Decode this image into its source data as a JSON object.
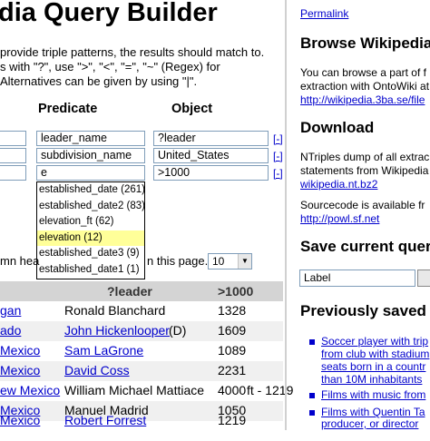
{
  "title": "dia Query Builder",
  "intro": [
    "provide triple patterns, the results should match to.",
    "s with \"?\", use \">\", \"<\", \"=\", \"~\" (Regex) for",
    "Alternatives can be given by using \"|\"."
  ],
  "columns": {
    "predicate": "Predicate",
    "object": "Object"
  },
  "patterns": [
    {
      "subject": "",
      "predicate": "leader_name",
      "object": "?leader",
      "remove": "[-]"
    },
    {
      "subject": "",
      "predicate": "subdivision_name",
      "object": "United_States",
      "remove": "[-]"
    },
    {
      "subject": "",
      "predicate": "e",
      "object": ">1000",
      "remove": "[-]"
    }
  ],
  "autocomplete": [
    "established_date (261)",
    "established_date2 (83)",
    "elevation_ft (62)",
    "elevation (12)",
    "established_date3 (9)",
    "established_date1 (1)"
  ],
  "autocomplete_selected_index": 3,
  "limit": {
    "prefix": "mn hea",
    "suffix": "n this page.",
    "value": "10"
  },
  "results": {
    "headers": [
      "",
      "?leader",
      ">1000"
    ],
    "rows": [
      [
        "gan",
        "Ronald Blanchard",
        "1328"
      ],
      [
        "ado",
        "John Hickenlooper",
        "1609"
      ],
      [
        "Mexico",
        "Sam LaGrone",
        "1089"
      ],
      [
        "Mexico",
        "David Coss",
        "2231"
      ],
      [
        "ew Mexico",
        "William Michael Mattiace",
        "4000"
      ],
      [
        "Mexico",
        "Manuel Madrid",
        "1050"
      ],
      [
        "Mexico",
        "Robert Forrest",
        "1219"
      ]
    ],
    "row2_extra": "(D)",
    "row5_extra": "ft - 1219"
  },
  "sidebar": {
    "permalink": "Permalink",
    "browse_title": "Browse Wikipedia",
    "browse_text": [
      "You can browse a part of f",
      "extraction with OntoWiki at"
    ],
    "browse_link": "http://wikipedia.3ba.se/file",
    "download_title": "Download",
    "download_text": [
      "NTriples dump of all extrac",
      "statements from Wikipedia"
    ],
    "download_link": "wikipedia.nt.bz2",
    "source_text": "Sourcecode is available fr",
    "source_link": "http://powl.sf.net",
    "save_title": "Save current quer",
    "save_placeholder": "Label",
    "saved_title": "Previously saved",
    "saved_items": [
      [
        "Soccer player with trip",
        "from club with stadium",
        "seats born in a countr",
        "than 10M inhabitants"
      ],
      [
        "Films with music from"
      ],
      [
        "Films with Quentin Ta",
        "producer, or director"
      ]
    ]
  }
}
